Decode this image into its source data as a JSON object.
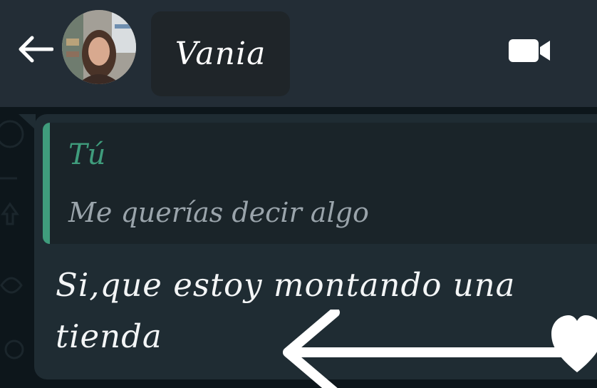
{
  "header": {
    "contact_name": "Vania",
    "back_icon": "arrow-left-icon",
    "video_icon": "video-camera-icon"
  },
  "conversation": {
    "quoted_message": {
      "author": "Tú",
      "text": "Me querías decir algo"
    },
    "message": {
      "lines": [
        "Si,que estoy montando una",
        "tienda"
      ]
    },
    "reaction_icon": "heart-icon"
  },
  "colors": {
    "header_bg": "#232d36",
    "bubble_bg": "#1f2c33",
    "quote_accent": "#3f9c7c",
    "chat_bg": "#0d161b"
  }
}
